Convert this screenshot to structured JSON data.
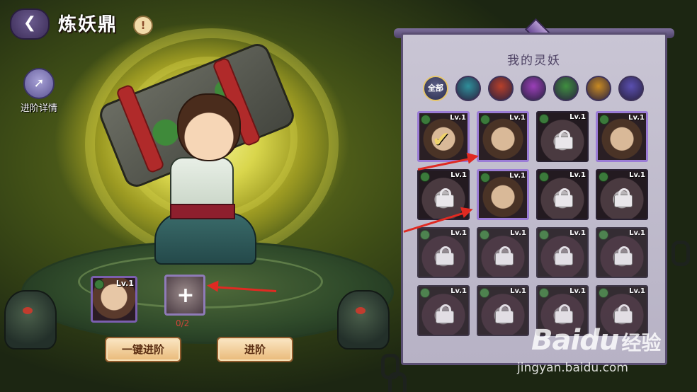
{
  "header": {
    "back_icon": "back-arrow-icon",
    "title": "炼妖鼎",
    "info_icon": "exclamation-icon",
    "info_symbol": "!"
  },
  "side": {
    "detail_icon": "scroll-icon",
    "detail_label": "进阶详情"
  },
  "stage": {
    "main_card": {
      "level": "Lv.1",
      "element_icon": "wood-element-icon"
    },
    "add_slot": {
      "icon": "plus-icon",
      "symbol": "+"
    },
    "progress": "0/2"
  },
  "buttons": {
    "one_click": "一键进阶",
    "advance": "进阶"
  },
  "panel": {
    "title": "我的灵妖",
    "tabs": [
      {
        "label": "全部",
        "icon": "all-filter-icon",
        "color": "#2b2e4e"
      },
      {
        "label": "",
        "icon": "water-element-icon",
        "color": "#2f8f9a"
      },
      {
        "label": "",
        "icon": "fire-element-icon",
        "color": "#b8402a"
      },
      {
        "label": "",
        "icon": "cloud-element-icon",
        "color": "#9b3fb8"
      },
      {
        "label": "",
        "icon": "wood-element-icon",
        "color": "#3f8f3f"
      },
      {
        "label": "",
        "icon": "light-element-icon",
        "color": "#c88a22"
      },
      {
        "label": "",
        "icon": "dark-element-icon",
        "color": "#5a4fb0"
      }
    ],
    "cards": [
      {
        "level": "Lv.1",
        "state": "selected"
      },
      {
        "level": "Lv.1",
        "state": "owned"
      },
      {
        "level": "Lv.1",
        "state": "locked"
      },
      {
        "level": "Lv.1",
        "state": "owned"
      },
      {
        "level": "Lv.1",
        "state": "locked"
      },
      {
        "level": "Lv.1",
        "state": "owned"
      },
      {
        "level": "Lv.1",
        "state": "locked"
      },
      {
        "level": "Lv.1",
        "state": "locked"
      },
      {
        "level": "Lv.1",
        "state": "dim"
      },
      {
        "level": "Lv.1",
        "state": "dim"
      },
      {
        "level": "Lv.1",
        "state": "dim"
      },
      {
        "level": "Lv.1",
        "state": "dim"
      },
      {
        "level": "Lv.1",
        "state": "dim"
      },
      {
        "level": "Lv.1",
        "state": "dim"
      },
      {
        "level": "Lv.1",
        "state": "dim"
      },
      {
        "level": "Lv.1",
        "state": "dim"
      }
    ]
  },
  "watermark": {
    "logo": "Baidu",
    "cn": "经验",
    "url": "jingyan.baidu.com"
  },
  "colors": {
    "accent_purple": "#9b7cd6",
    "annotation_red": "#e02a22",
    "button_gold": "#e9b978"
  }
}
